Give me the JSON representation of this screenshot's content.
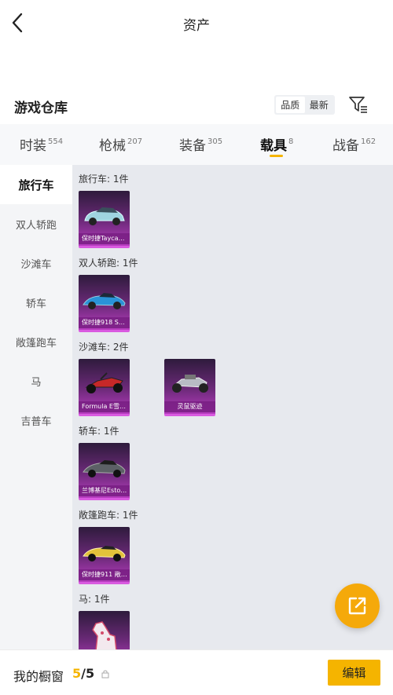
{
  "header": {
    "title": "资产"
  },
  "section": {
    "title": "游戏仓库"
  },
  "sort": {
    "options": [
      "品质",
      "最新"
    ]
  },
  "tabs": [
    {
      "label": "时装",
      "count": "554"
    },
    {
      "label": "枪械",
      "count": "207"
    },
    {
      "label": "装备",
      "count": "305"
    },
    {
      "label": "载具",
      "count": "8"
    },
    {
      "label": "战备",
      "count": "162"
    }
  ],
  "sidebar": {
    "items": [
      "旅行车",
      "双人轿跑",
      "沙滩车",
      "轿车",
      "敞篷跑车",
      "马",
      "吉普车"
    ]
  },
  "groups": [
    {
      "label": "旅行车: 1件",
      "items": [
        {
          "name": "保时捷Tayca…"
        }
      ]
    },
    {
      "label": "双人轿跑: 1件",
      "items": [
        {
          "name": "保时捷918 S…"
        }
      ]
    },
    {
      "label": "沙滩车: 2件",
      "items": [
        {
          "name": "Formula E雪…"
        },
        {
          "name": "灵鼠驱迹"
        }
      ]
    },
    {
      "label": "轿车: 1件",
      "items": [
        {
          "name": "兰博基尼Esto…"
        }
      ]
    },
    {
      "label": "敞篷跑车: 1件",
      "items": [
        {
          "name": "保时捷911 敞…"
        }
      ]
    },
    {
      "label": "马: 1件",
      "items": []
    }
  ],
  "footer": {
    "label": "我的橱窗",
    "current": "5",
    "total": "/5",
    "edit": "编辑"
  },
  "colors": {
    "accent": "#f5b400",
    "card": "#6d2a7a"
  }
}
